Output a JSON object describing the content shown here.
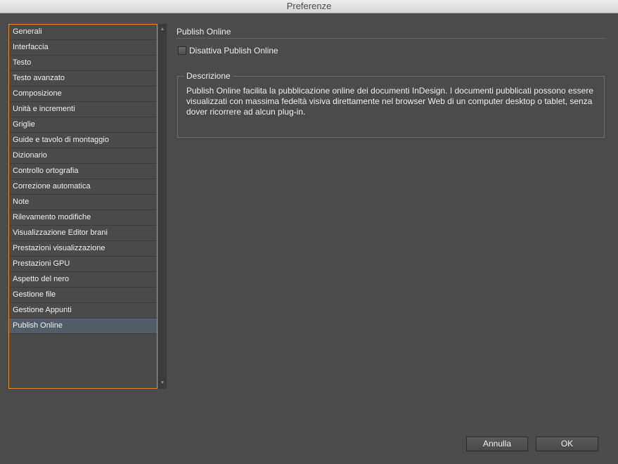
{
  "window": {
    "title": "Preferenze"
  },
  "sidebar": {
    "items": [
      {
        "label": "Generali"
      },
      {
        "label": "Interfaccia"
      },
      {
        "label": "Testo"
      },
      {
        "label": "Testo avanzato"
      },
      {
        "label": "Composizione"
      },
      {
        "label": "Unità e incrementi"
      },
      {
        "label": "Griglie"
      },
      {
        "label": "Guide e tavolo di montaggio"
      },
      {
        "label": "Dizionario"
      },
      {
        "label": "Controllo ortografia"
      },
      {
        "label": "Correzione automatica"
      },
      {
        "label": "Note"
      },
      {
        "label": "Rilevamento modifiche"
      },
      {
        "label": "Visualizzazione Editor brani"
      },
      {
        "label": "Prestazioni visualizzazione"
      },
      {
        "label": "Prestazioni GPU"
      },
      {
        "label": "Aspetto del nero"
      },
      {
        "label": "Gestione file"
      },
      {
        "label": "Gestione Appunti"
      },
      {
        "label": "Publish Online"
      }
    ],
    "selected": "Publish Online"
  },
  "panel": {
    "title": "Publish Online",
    "disable_checkbox": {
      "label": "Disattiva Publish Online",
      "checked": false
    },
    "description": {
      "legend": "Descrizione",
      "text": "Publish Online facilita la pubblicazione online dei documenti InDesign. I documenti pubblicati possono essere visualizzati con massima fedeltà visiva direttamente nel browser Web di un computer desktop o tablet, senza dover ricorrere ad alcun plug-in."
    }
  },
  "buttons": {
    "cancel": "Annulla",
    "ok": "OK"
  },
  "colors": {
    "accent": "#e8892f",
    "selection": "#535c69"
  }
}
